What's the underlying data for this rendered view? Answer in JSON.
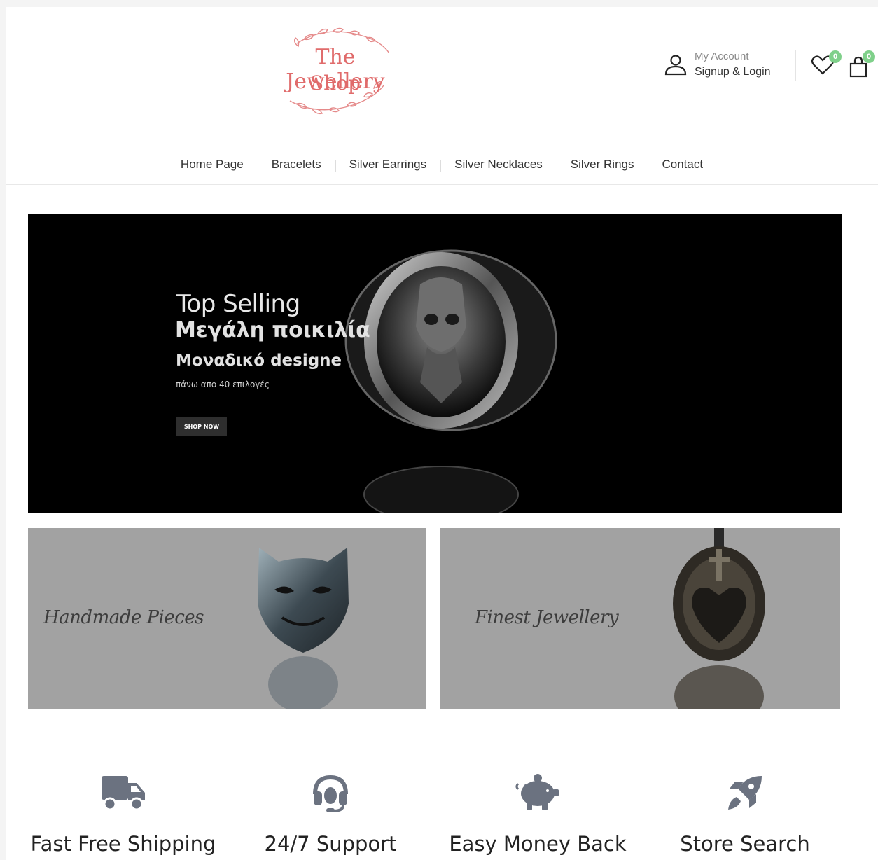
{
  "brand": {
    "logo_line1": "The Jewellery",
    "logo_line2": "Shop"
  },
  "account": {
    "small_label": "My Account",
    "big_label": "Signup & Login"
  },
  "wishlist": {
    "count": "0"
  },
  "cart": {
    "count": "0"
  },
  "nav": {
    "items": [
      {
        "label": "Home Page"
      },
      {
        "label": "Bracelets"
      },
      {
        "label": "Silver Earrings"
      },
      {
        "label": "Silver Necklaces"
      },
      {
        "label": "Silver Rings"
      },
      {
        "label": "Contact"
      }
    ]
  },
  "hero": {
    "line1": "Top Selling",
    "line2": "Μεγάλη ποικιλία",
    "line3": "Μοναδικό designe",
    "line4": "πάνω απο 40 επιλογές",
    "button": "SHOP NOW"
  },
  "promos": [
    {
      "label": "Handmade Pieces"
    },
    {
      "label": "Finest Jewellery"
    }
  ],
  "features": [
    {
      "icon": "truck-icon",
      "title": "Fast Free Shipping"
    },
    {
      "icon": "headset-icon",
      "title": "24/7 Support"
    },
    {
      "icon": "piggy-bank-icon",
      "title": "Easy Money Back"
    },
    {
      "icon": "rocket-icon",
      "title": "Store Search"
    }
  ],
  "colors": {
    "badge": "#7fd08a",
    "logo": "#e06b6b",
    "promo_bg": "#a2a2a2",
    "feature_icon": "#6b7280"
  }
}
